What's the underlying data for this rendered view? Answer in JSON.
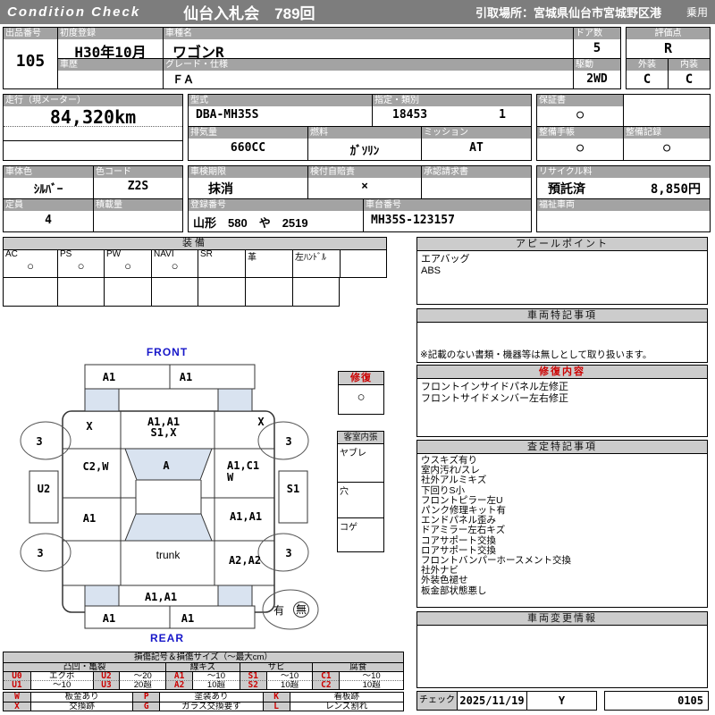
{
  "topbar": {
    "brand": "Condition  Check",
    "auction": "仙台入札会　789回",
    "pickup": "引取場所：宮城県仙台市宮城野区港",
    "category": "乗用"
  },
  "fields": {
    "lot_no": {
      "label": "出品番号",
      "value": "105"
    },
    "first_reg": {
      "label": "初度登録",
      "value": "H30年10月"
    },
    "model_name": {
      "label": "車種名",
      "value": "ワゴンR"
    },
    "history": {
      "label": "車歴",
      "value": ""
    },
    "grade": {
      "label": "グレード・仕様",
      "value": "ＦＡ"
    },
    "doors": {
      "label": "ドア数",
      "value": "5"
    },
    "drive": {
      "label": "駆動",
      "value": "2WD"
    },
    "rating": {
      "label": "評価点",
      "value": "R"
    },
    "exterior": {
      "label": "外装",
      "value": "C"
    },
    "interior": {
      "label": "内装",
      "value": "C"
    },
    "odometer": {
      "label": "走行（現メーター）",
      "value": "84,320km"
    },
    "model_code": {
      "label": "型式",
      "value": "DBA-MH35S"
    },
    "designation": {
      "label": "指定・類別",
      "value1": "18453",
      "value2": "1"
    },
    "displacement": {
      "label": "排気量",
      "value": "660CC"
    },
    "fuel": {
      "label": "燃料",
      "value": "ｶﾞｿﾘﾝ"
    },
    "transmission": {
      "label": "ミッション",
      "value": "AT"
    },
    "warranty": {
      "label": "保証書",
      "value": "○"
    },
    "maintenance_book": {
      "label": "整備手帳",
      "value": "○"
    },
    "maintenance_record": {
      "label": "整備記録",
      "value": "○"
    },
    "body_color": {
      "label": "車体色",
      "value": "ｼﾙﾊﾞｰ"
    },
    "color_code": {
      "label": "色コード",
      "value": "Z2S"
    },
    "inspection_expiry": {
      "label": "車検期限",
      "value": "抹消"
    },
    "insurance": {
      "label": "検付自賠責",
      "value": "×"
    },
    "approval_request": {
      "label": "承認請求書",
      "value": ""
    },
    "recycle": {
      "label": "リサイクル料",
      "status": "預託済",
      "fee": "8,850円"
    },
    "capacity": {
      "label": "定員",
      "value": "4"
    },
    "payload": {
      "label": "積載量",
      "value": ""
    },
    "reg_number": {
      "label": "登録番号",
      "value": "山形　580　や　2519"
    },
    "chassis_no": {
      "label": "車台番号",
      "value": "MH35S-123157"
    },
    "welfare": {
      "label": "福祉車両",
      "value": ""
    }
  },
  "equipment": {
    "header": "装備",
    "labels": [
      "AC",
      "PS",
      "PW",
      "NAVI",
      "SR",
      "革",
      "左ﾊﾝﾄﾞﾙ",
      ""
    ],
    "marks": [
      "○",
      "○",
      "○",
      "○",
      "",
      "",
      "",
      ""
    ]
  },
  "appeal": {
    "header": "アピールポイント",
    "lines": [
      "エアバッグ",
      "ABS"
    ]
  },
  "special_notes": {
    "header": "車両特記事項",
    "note": "※記載のない書類・機器等は無しとして取り扱います。"
  },
  "repair_details": {
    "header": "修復内容",
    "lines": [
      "フロントインサイドパネル左修正",
      "フロントサイドメンバー左右修正"
    ]
  },
  "assessment_notes": {
    "header": "査定特記事項",
    "lines": [
      "ウスキズ有り",
      "室内汚れ/スレ",
      "社外アルミキズ",
      "下回りS小",
      "フロントピラー左U",
      "パンク修理キット有",
      "エンドパネル歪み",
      "ドアミラー左右キズ",
      "コアサポート交換",
      "ロアサポート交換",
      "フロントバンパーホースメント交換",
      "社外ナビ",
      "外装色褪せ",
      "板金部状態悪し"
    ]
  },
  "change_info": {
    "header": "車両変更情報"
  },
  "check": {
    "label": "チェック",
    "date": "2025/11/19",
    "inspector": "Y",
    "sheet_no": "0105"
  },
  "diagram": {
    "front_label": "FRONT",
    "rear_label": "REAR",
    "panels": {
      "front_bumper_left": "A1",
      "front_bumper_right": "A1",
      "front_fender_left": "X",
      "front_fender_right": "X",
      "hood_line1": "A1,A1",
      "hood_line2": "S1,X",
      "windshield": "A",
      "front_door_left": "C2,W",
      "front_door_right_line1": "A1,C1",
      "front_door_right_line2": "W",
      "sill_left": "U2",
      "sill_right": "S1",
      "rear_door_left": "A1",
      "rear_door_right": "A1,A1",
      "trunk": "trunk",
      "rear_quarter_right": "A2,A2",
      "rear_panel": "A1,A1",
      "rear_bumper_left": "A1",
      "rear_bumper_right": "A1",
      "wheel_front_left": "3",
      "wheel_front_right": "3",
      "wheel_rear_left": "3",
      "wheel_rear_right": "3"
    },
    "spare_tire": {
      "present_label": "有",
      "absent_label": "無"
    },
    "repair_box": {
      "header": "修復",
      "mark": "○"
    },
    "interior_box": {
      "header": "客室内張",
      "items": [
        "ヤブレ",
        "穴",
        "コゲ"
      ]
    }
  },
  "legend": {
    "title": "損傷記号＆損傷サイズ（〜最大cm）",
    "groups": [
      "凸凹・亀裂",
      "線キズ",
      "サビ",
      "腐食"
    ],
    "size_rows": [
      [
        "U0",
        "エクボ",
        "U2",
        "〜20",
        "A1",
        "〜10",
        "S1",
        "〜10",
        "C1",
        "〜10"
      ],
      [
        "U1",
        "〜10",
        "U3",
        "20超",
        "A2",
        "10超",
        "S2",
        "10超",
        "C2",
        "10超"
      ]
    ],
    "mark_rows": [
      [
        "W",
        "板金あり",
        "P",
        "塗装あり",
        "K",
        "看板跡"
      ],
      [
        "X",
        "交換跡",
        "G",
        "ガラス交換要す",
        "L",
        "レンズ割れ"
      ]
    ]
  },
  "colors": {
    "accent_red": "#cc0000",
    "accent_blue": "#1717c9",
    "panel_blue": "#d9e3f0",
    "band_gray": "#a3a3a3"
  }
}
